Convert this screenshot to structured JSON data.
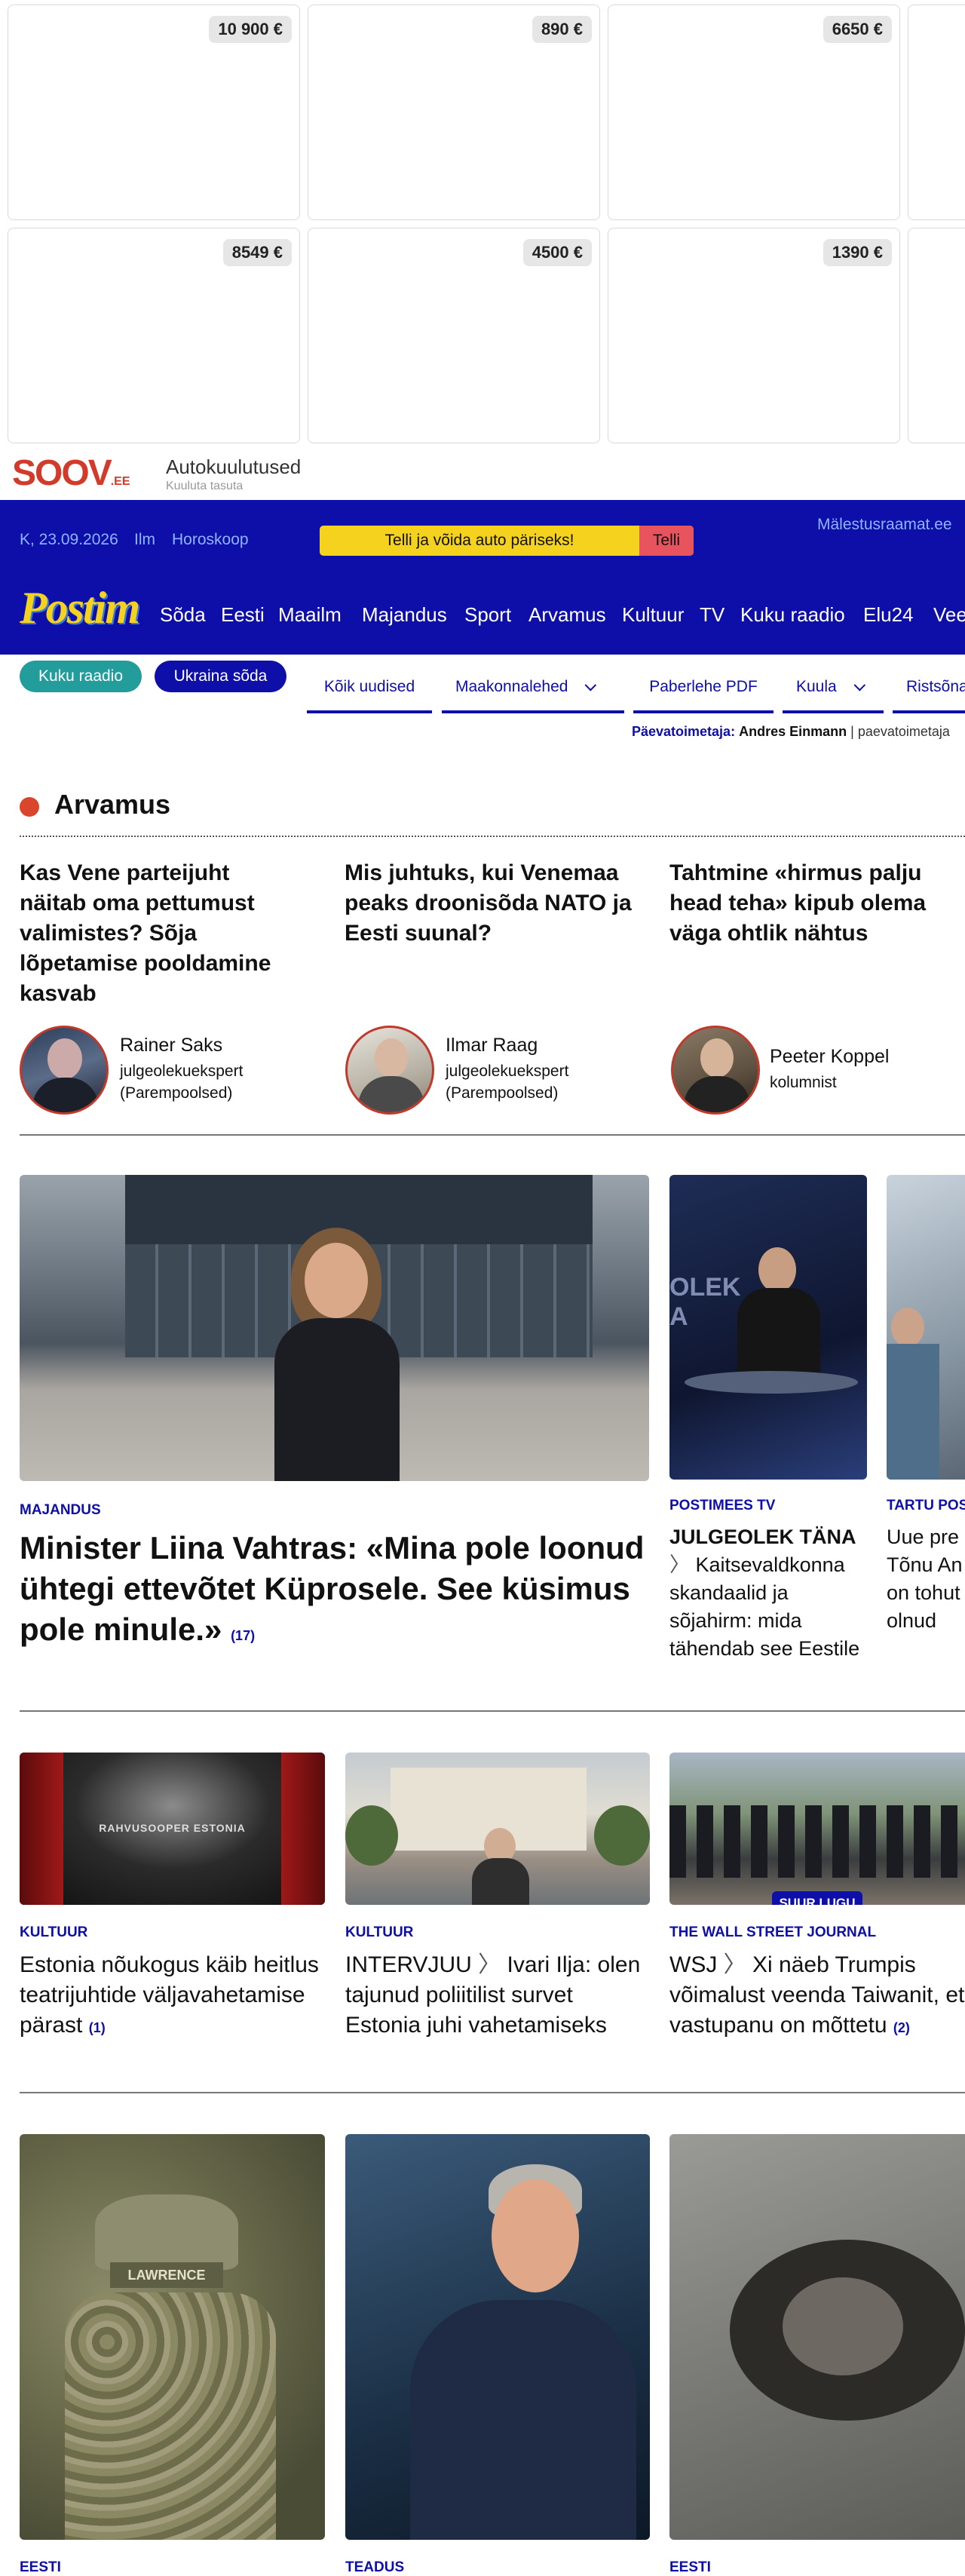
{
  "ads": {
    "prices": [
      "10 900 €",
      "890 €",
      "6650 €",
      "8549 €",
      "4500 €",
      "1390 €"
    ]
  },
  "soov": {
    "logo": "SOOV",
    "logo_suffix": ".EE",
    "title": "Autokuulutused",
    "subtitle": "Kuuluta tasuta"
  },
  "topbar": {
    "date": "K, 23.09.2026",
    "weather": "Ilm",
    "horoscope": "Horoskoop",
    "promo": "Telli ja võida auto päriseks!",
    "promo_button": "Telli",
    "memorial": "Mälestusraamat.ee"
  },
  "brand": {
    "logo": "Postim"
  },
  "nav": [
    "Sõda",
    "Eesti",
    "Maailm",
    "Majandus",
    "Sport",
    "Arvamus",
    "Kultuur",
    "TV",
    "Kuku raadio",
    "Elu24",
    "Vee"
  ],
  "pills": {
    "radio": "Kuku raadio",
    "war": "Ukraina sõda"
  },
  "tabs": [
    "Kõik uudised",
    "Maakonnalehed",
    "Paberlehe PDF",
    "Kuula",
    "Ristsõna"
  ],
  "editor": {
    "label": "Päevatoimetaja:",
    "name": "Andres Einmann",
    "extra": "paevatoimetaja"
  },
  "opinion": {
    "section": "Arvamus",
    "items": [
      {
        "title": "Kas Vene parteijuht näitab oma pettumust valimistes? Sõja lõpetamise pooldamine kasvab",
        "author": "Rainer Saks",
        "role1": "julgeolekuekspert",
        "role2": "(Parempoolsed)"
      },
      {
        "title": "Mis juhtuks, kui Venemaa peaks droonisõda NATO ja Eesti suunal?",
        "author": "Ilmar Raag",
        "role1": "julgeolekuekspert",
        "role2": "(Parempoolsed)"
      },
      {
        "title": "Tahtmine «hirmus palju head teha» kipub olema väga ohtlik nähtus",
        "author": "Peeter Koppel",
        "role1": "kolumnist",
        "role2": ""
      }
    ]
  },
  "main": {
    "category": "MAJANDUS",
    "title": "Minister Liina Vahtras: «Mina pole loonud ühtegi ettevõtet Küprosele. See küsimus pole minule.»",
    "count": "(17)"
  },
  "side1": {
    "category": "POSTIMEES TV",
    "prefix": "JULGEOLEK TÄNA",
    "title": "Kaitsevaldkonna skandaalid ja sõjahirm: mida tähendab see Eestile"
  },
  "side2": {
    "category": "TARTU POS",
    "title": "Uue pre Tõnu An on tohut olnud"
  },
  "row2": [
    {
      "category": "KULTUUR",
      "title": "Estonia nõukogus käib heitlus teatrijuhtide väljavahetamise pärast",
      "count": "(1)",
      "overlay": "RAHVUSOOPER ESTONIA"
    },
    {
      "category": "KULTUUR",
      "prefix": "INTERVJUU",
      "title": "Ivari Ilja: olen tajunud poliitilist survet Estonia juhi vahetamiseks"
    },
    {
      "category": "THE WALL STREET JOURNAL",
      "prefix": "WSJ",
      "title": "Xi näeb Trumpis võimalust veenda Taiwanit, et vastupanu on mõttetu",
      "count": "(2)",
      "badge": "SUUR LUGU"
    }
  ],
  "row3": [
    {
      "category": "EESTI",
      "patch": "LAWRENCE"
    },
    {
      "category": "TEADUS"
    },
    {
      "category": "EESTI"
    }
  ]
}
